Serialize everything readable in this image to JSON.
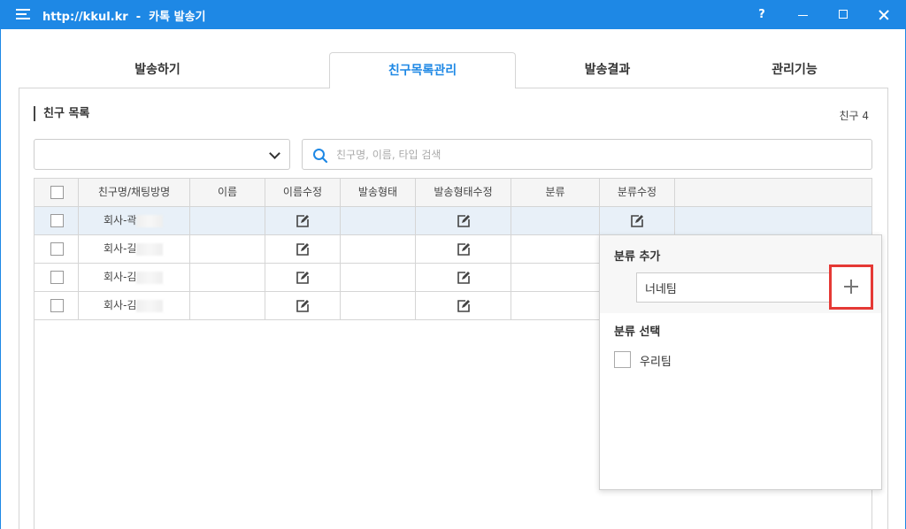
{
  "window": {
    "title": "http://kkul.kr  -  카톡 발송기",
    "help": "?"
  },
  "tabs": [
    {
      "label": "발송하기",
      "active": false
    },
    {
      "label": "친구목록관리",
      "active": true
    },
    {
      "label": "발송결과",
      "active": false
    },
    {
      "label": "관리기능",
      "active": false
    }
  ],
  "section": {
    "title": "친구 목록",
    "count": "친구 4"
  },
  "filter": {
    "selected": ""
  },
  "search": {
    "placeholder": "친구명, 이름, 타입 검색"
  },
  "table": {
    "headers": [
      "",
      "친구명/채팅방명",
      "이름",
      "이름수정",
      "발송형태",
      "발송형태수정",
      "분류",
      "분류수정"
    ],
    "rows": [
      {
        "name": "회사-곽",
        "selected": true
      },
      {
        "name": "회사-길",
        "selected": false
      },
      {
        "name": "회사-김",
        "selected": false
      },
      {
        "name": "회사-김",
        "selected": false
      }
    ]
  },
  "popup": {
    "add_title": "분류 추가",
    "add_value": "너네팀",
    "select_title": "분류 선택",
    "options": [
      {
        "label": "우리팀",
        "checked": false
      }
    ]
  },
  "colors": {
    "accent": "#1e88e5",
    "highlight_border": "#e53935"
  }
}
